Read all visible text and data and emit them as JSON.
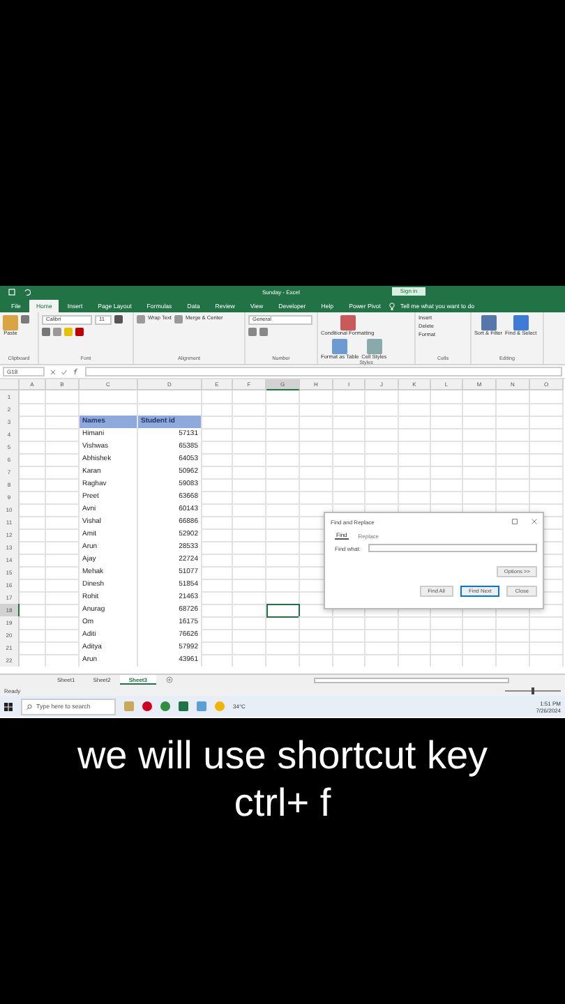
{
  "title_bar": {
    "title": "Sunday - Excel",
    "sign_in": "Sign in"
  },
  "ribbon_tabs": [
    {
      "label": "File",
      "selected": false
    },
    {
      "label": "Home",
      "selected": true
    },
    {
      "label": "Insert",
      "selected": false
    },
    {
      "label": "Page Layout",
      "selected": false
    },
    {
      "label": "Formulas",
      "selected": false
    },
    {
      "label": "Data",
      "selected": false
    },
    {
      "label": "Review",
      "selected": false
    },
    {
      "label": "View",
      "selected": false
    },
    {
      "label": "Developer",
      "selected": false
    },
    {
      "label": "Help",
      "selected": false
    },
    {
      "label": "Power Pivot",
      "selected": false
    }
  ],
  "tell_me": "Tell me what you want to do",
  "ribbon": {
    "paste": "Paste",
    "font_name": "Calibri",
    "font_size": "11",
    "wrap_text": "Wrap Text",
    "merge": "Merge & Center",
    "number_format": "General",
    "conditional": "Conditional Formatting",
    "format_table": "Format as Table",
    "cell_styles": "Cell Styles",
    "insert": "Insert",
    "delete": "Delete",
    "format": "Format",
    "sort": "Sort & Filter",
    "find": "Find & Select",
    "groups": [
      "Clipboard",
      "Font",
      "Alignment",
      "Number",
      "Styles",
      "Cells",
      "Editing"
    ]
  },
  "name_box": "G18",
  "columns": [
    {
      "label": "A",
      "selected": false
    },
    {
      "label": "B",
      "selected": false
    },
    {
      "label": "C",
      "selected": false
    },
    {
      "label": "D",
      "selected": false
    },
    {
      "label": "E",
      "selected": false
    },
    {
      "label": "F",
      "selected": false
    },
    {
      "label": "G",
      "selected": true
    },
    {
      "label": "H",
      "selected": false
    },
    {
      "label": "I",
      "selected": false
    },
    {
      "label": "J",
      "selected": false
    },
    {
      "label": "K",
      "selected": false
    },
    {
      "label": "L",
      "selected": false
    },
    {
      "label": "M",
      "selected": false
    },
    {
      "label": "N",
      "selected": false
    },
    {
      "label": "O",
      "selected": false
    }
  ],
  "rows": [
    {
      "number": "1",
      "kind": "blank",
      "selected": false
    },
    {
      "number": "2",
      "kind": "blank",
      "selected": false
    },
    {
      "number": "3",
      "kind": "header",
      "name": "Names",
      "id": "Student id",
      "selected": false
    },
    {
      "number": "4",
      "kind": "data",
      "name": "Himani",
      "id": "57131",
      "selected": false
    },
    {
      "number": "5",
      "kind": "data",
      "name": "Vishwas",
      "id": "65385",
      "selected": false
    },
    {
      "number": "6",
      "kind": "data",
      "name": "Abhishek",
      "id": "64053",
      "selected": false
    },
    {
      "number": "7",
      "kind": "data",
      "name": "Karan",
      "id": "50962",
      "selected": false
    },
    {
      "number": "8",
      "kind": "data",
      "name": "Raghav",
      "id": "59083",
      "selected": false
    },
    {
      "number": "9",
      "kind": "data",
      "name": "Preet",
      "id": "63668",
      "selected": false
    },
    {
      "number": "10",
      "kind": "data",
      "name": "Avni",
      "id": "60143",
      "selected": false
    },
    {
      "number": "11",
      "kind": "data",
      "name": "Vishal",
      "id": "66886",
      "selected": false
    },
    {
      "number": "12",
      "kind": "data",
      "name": "Amit",
      "id": "52902",
      "selected": false
    },
    {
      "number": "13",
      "kind": "data",
      "name": "Arun",
      "id": "28533",
      "selected": false
    },
    {
      "number": "14",
      "kind": "data",
      "name": "Ajay",
      "id": "22724",
      "selected": false
    },
    {
      "number": "15",
      "kind": "data",
      "name": "Mehak",
      "id": "51077",
      "selected": false
    },
    {
      "number": "16",
      "kind": "data",
      "name": "Dinesh",
      "id": "51854",
      "selected": false
    },
    {
      "number": "17",
      "kind": "data",
      "name": "Rohit",
      "id": "21463",
      "selected": false
    },
    {
      "number": "18",
      "kind": "data",
      "name": "Anurag",
      "id": "68726",
      "selected": true
    },
    {
      "number": "19",
      "kind": "data",
      "name": "Om",
      "id": "16175",
      "selected": false
    },
    {
      "number": "20",
      "kind": "data",
      "name": "Aditi",
      "id": "76626",
      "selected": false
    },
    {
      "number": "21",
      "kind": "data",
      "name": "Aditya",
      "id": "57992",
      "selected": false
    },
    {
      "number": "22",
      "kind": "data",
      "name": "Arun",
      "id": "43961",
      "selected": false
    }
  ],
  "dialog": {
    "title": "Find and Replace",
    "tabs": [
      {
        "label": "Find",
        "selected": true
      },
      {
        "label": "Replace",
        "selected": false
      }
    ],
    "find_label": "Find what:",
    "options": "Options >>",
    "buttons": [
      {
        "label": "Find All",
        "selected": false
      },
      {
        "label": "Find Next",
        "selected": true
      },
      {
        "label": "Close",
        "selected": false
      }
    ]
  },
  "sheets": [
    {
      "label": "Sheet1",
      "selected": false
    },
    {
      "label": "Sheet2",
      "selected": false
    },
    {
      "label": "Sheet3",
      "selected": true
    }
  ],
  "status": "Ready",
  "zoom": {
    "level": 0.5
  },
  "taskbar": {
    "search_placeholder": "Type here to search",
    "weather": "34°C",
    "time": "1:51 PM",
    "date": "7/26/2024"
  },
  "caption": [
    "we will use shortcut key",
    "ctrl+ f"
  ]
}
